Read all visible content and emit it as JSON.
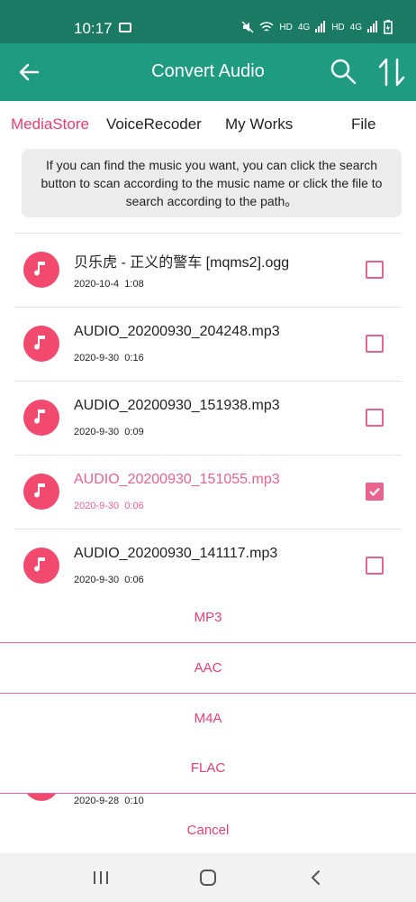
{
  "status_bar": {
    "time": "10:17",
    "indicators": [
      "HD",
      "4G",
      "HD",
      "4G"
    ]
  },
  "app_bar": {
    "title": "Convert Audio",
    "back_icon": "arrow-left-icon",
    "search_icon": "search-icon",
    "sort_icon": "sort-icon",
    "color": "#1e9b80"
  },
  "tabs": [
    {
      "label": "MediaStore",
      "active": true
    },
    {
      "label": "VoiceRecoder",
      "active": false
    },
    {
      "label": "My Works",
      "active": false
    },
    {
      "label": "File",
      "active": false
    }
  ],
  "notice": "If you can find the music you want, you can click the search button to scan according to the music name or click the file to search according to the path。",
  "files": [
    {
      "name": "贝乐虎 - 正义的警车 [mqms2].ogg",
      "date": "2020-10-4",
      "duration": "1:08",
      "checked": false
    },
    {
      "name": "AUDIO_20200930_204248.mp3",
      "date": "2020-9-30",
      "duration": "0:16",
      "checked": false
    },
    {
      "name": "AUDIO_20200930_151938.mp3",
      "date": "2020-9-30",
      "duration": "0:09",
      "checked": false
    },
    {
      "name": "AUDIO_20200930_151055.mp3",
      "date": "2020-9-30",
      "duration": "0:06",
      "checked": true
    },
    {
      "name": "AUDIO_20200930_141117.mp3",
      "date": "2020-9-30",
      "duration": "0:06",
      "checked": false
    }
  ],
  "partial_file": {
    "date": "2020-9-28",
    "duration": "0:10"
  },
  "formats": [
    "MP3",
    "AAC",
    "M4A",
    "FLAC"
  ],
  "cancel_label": "Cancel",
  "accent_color": "#e83e72"
}
